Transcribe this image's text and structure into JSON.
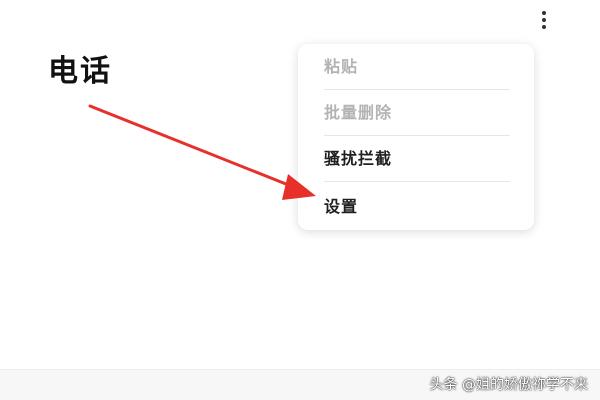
{
  "header": {
    "title": "电话",
    "more_icon": "more-vertical-icon"
  },
  "menu": {
    "items": [
      {
        "label": "粘贴",
        "enabled": false
      },
      {
        "label": "批量删除",
        "enabled": false
      },
      {
        "label": "骚扰拦截",
        "enabled": true
      },
      {
        "label": "设置",
        "enabled": true
      }
    ]
  },
  "annotation": {
    "arrow_color": "#e8302a"
  },
  "watermark": {
    "text": "头条 @姐的娇傲祢学不来"
  }
}
